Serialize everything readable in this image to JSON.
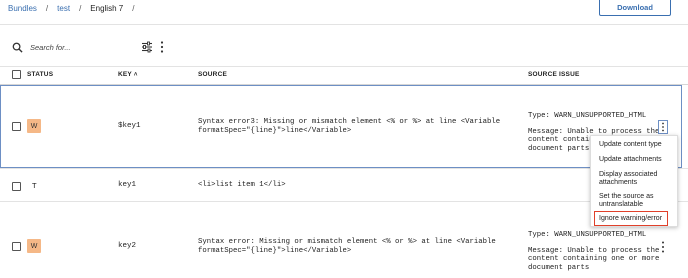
{
  "breadcrumb": {
    "items": [
      "Bundles",
      "test"
    ],
    "current": "English 7",
    "separator": "/"
  },
  "toolbar": {
    "download_label": "Download",
    "search_placeholder": "Search for..."
  },
  "table": {
    "headers": {
      "status": "STATUS",
      "key": "KEY",
      "sort_indicator": "˄",
      "source": "SOURCE",
      "source_issue": "SOURCE ISSUE"
    },
    "rows": [
      {
        "status": "W",
        "key": "$key1",
        "source_line1": "Syntax error3: Missing or mismatch element <% or %> at line <Variable",
        "source_line2": "formatSpec=\"{line}\">line</Variable>",
        "issue_type": "Type: WARN_UNSUPPORTED_HTML",
        "issue_msg_line1": "Message: Unable to process the",
        "issue_msg_line2": "content containing",
        "issue_msg_line3": "document parts"
      },
      {
        "status": "T",
        "key": "key1",
        "source_line1": "<li>list item 1</li>"
      },
      {
        "status": "W",
        "key": "key2",
        "source_line1": "Syntax error: Missing or mismatch element <% or %> at line <Variable",
        "source_line2": "formatSpec=\"{line}\">line</Variable>",
        "issue_type": "Type: WARN_UNSUPPORTED_HTML",
        "issue_msg_line1": "Message: Unable to process the",
        "issue_msg_line2": "content containing one or more",
        "issue_msg_line3": "document parts"
      }
    ]
  },
  "context_menu": {
    "items": [
      "Update content type",
      "Update attachments",
      "Display associated attachments",
      "Set the source as untranslatable",
      "Ignore warning/error"
    ]
  },
  "colors": {
    "accent": "#3a6fb0",
    "warning_badge": "#f5b887",
    "highlight_border": "#e0402a"
  }
}
